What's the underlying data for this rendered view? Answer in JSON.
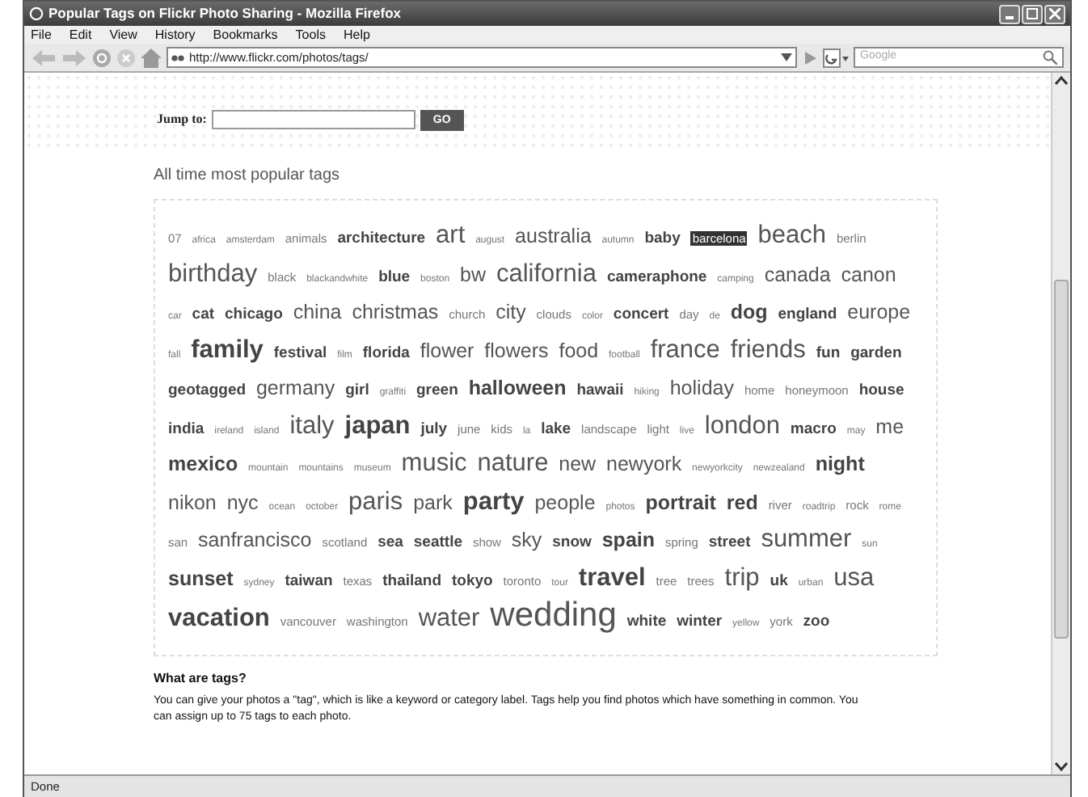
{
  "window": {
    "title": "Popular Tags on Flickr Photo Sharing - Mozilla Firefox"
  },
  "menu": [
    "File",
    "Edit",
    "View",
    "History",
    "Bookmarks",
    "Tools",
    "Help"
  ],
  "address_bar": {
    "url": "http://www.flickr.com/photos/tags/"
  },
  "search": {
    "placeholder": "Google"
  },
  "jump": {
    "label": "Jump to:",
    "button": "GO"
  },
  "heading": "All time most popular tags",
  "tags": [
    {
      "label": "07",
      "kind": "small",
      "bold": false,
      "selected": false
    },
    {
      "label": "africa",
      "kind": "tiny",
      "bold": false,
      "selected": false
    },
    {
      "label": "amsterdam",
      "kind": "tiny",
      "bold": false,
      "selected": false
    },
    {
      "label": "animals",
      "kind": "small",
      "bold": false,
      "selected": false
    },
    {
      "label": "architecture",
      "kind": "medium",
      "bold": true,
      "selected": false
    },
    {
      "label": "art",
      "kind": "huge",
      "bold": false,
      "selected": false
    },
    {
      "label": "august",
      "kind": "tiny",
      "bold": false,
      "selected": false
    },
    {
      "label": "australia",
      "kind": "large",
      "bold": false,
      "selected": false
    },
    {
      "label": "autumn",
      "kind": "tiny",
      "bold": false,
      "selected": false
    },
    {
      "label": "baby",
      "kind": "medium",
      "bold": true,
      "selected": false
    },
    {
      "label": "barcelona",
      "kind": "small",
      "bold": false,
      "selected": true
    },
    {
      "label": "beach",
      "kind": "huge",
      "bold": false,
      "selected": false
    },
    {
      "label": "berlin",
      "kind": "small",
      "bold": false,
      "selected": false
    },
    {
      "label": "birthday",
      "kind": "huge",
      "bold": false,
      "selected": false
    },
    {
      "label": "black",
      "kind": "small",
      "bold": false,
      "selected": false
    },
    {
      "label": "blackandwhite",
      "kind": "tiny",
      "bold": false,
      "selected": false
    },
    {
      "label": "blue",
      "kind": "medium",
      "bold": true,
      "selected": false
    },
    {
      "label": "boston",
      "kind": "tiny",
      "bold": false,
      "selected": false
    },
    {
      "label": "bw",
      "kind": "large",
      "bold": false,
      "selected": false
    },
    {
      "label": "california",
      "kind": "huge",
      "bold": false,
      "selected": false
    },
    {
      "label": "cameraphone",
      "kind": "medium",
      "bold": true,
      "selected": false
    },
    {
      "label": "camping",
      "kind": "tiny",
      "bold": false,
      "selected": false
    },
    {
      "label": "canada",
      "kind": "large",
      "bold": false,
      "selected": false
    },
    {
      "label": "canon",
      "kind": "large",
      "bold": false,
      "selected": false
    },
    {
      "label": "car",
      "kind": "tiny",
      "bold": false,
      "selected": false
    },
    {
      "label": "cat",
      "kind": "medium",
      "bold": true,
      "selected": false
    },
    {
      "label": "chicago",
      "kind": "medium",
      "bold": true,
      "selected": false
    },
    {
      "label": "china",
      "kind": "large",
      "bold": false,
      "selected": false
    },
    {
      "label": "christmas",
      "kind": "large",
      "bold": false,
      "selected": false
    },
    {
      "label": "church",
      "kind": "small",
      "bold": false,
      "selected": false
    },
    {
      "label": "city",
      "kind": "large",
      "bold": false,
      "selected": false
    },
    {
      "label": "clouds",
      "kind": "small",
      "bold": false,
      "selected": false
    },
    {
      "label": "color",
      "kind": "tiny",
      "bold": false,
      "selected": false
    },
    {
      "label": "concert",
      "kind": "medium",
      "bold": true,
      "selected": false
    },
    {
      "label": "day",
      "kind": "small",
      "bold": false,
      "selected": false
    },
    {
      "label": "de",
      "kind": "tiny",
      "bold": false,
      "selected": false
    },
    {
      "label": "dog",
      "kind": "large",
      "bold": true,
      "selected": false
    },
    {
      "label": "england",
      "kind": "medium",
      "bold": true,
      "selected": false
    },
    {
      "label": "europe",
      "kind": "large",
      "bold": false,
      "selected": false
    },
    {
      "label": "fall",
      "kind": "tiny",
      "bold": false,
      "selected": false
    },
    {
      "label": "family",
      "kind": "huge",
      "bold": true,
      "selected": false
    },
    {
      "label": "festival",
      "kind": "medium",
      "bold": true,
      "selected": false
    },
    {
      "label": "film",
      "kind": "tiny",
      "bold": false,
      "selected": false
    },
    {
      "label": "florida",
      "kind": "medium",
      "bold": true,
      "selected": false
    },
    {
      "label": "flower",
      "kind": "large",
      "bold": false,
      "selected": false
    },
    {
      "label": "flowers",
      "kind": "large",
      "bold": false,
      "selected": false
    },
    {
      "label": "food",
      "kind": "large",
      "bold": false,
      "selected": false
    },
    {
      "label": "football",
      "kind": "tiny",
      "bold": false,
      "selected": false
    },
    {
      "label": "france",
      "kind": "huge",
      "bold": false,
      "selected": false
    },
    {
      "label": "friends",
      "kind": "huge",
      "bold": false,
      "selected": false
    },
    {
      "label": "fun",
      "kind": "medium",
      "bold": true,
      "selected": false
    },
    {
      "label": "garden",
      "kind": "medium",
      "bold": true,
      "selected": false
    },
    {
      "label": "geotagged",
      "kind": "medium",
      "bold": true,
      "selected": false
    },
    {
      "label": "germany",
      "kind": "large",
      "bold": false,
      "selected": false
    },
    {
      "label": "girl",
      "kind": "medium",
      "bold": true,
      "selected": false
    },
    {
      "label": "graffiti",
      "kind": "tiny",
      "bold": false,
      "selected": false
    },
    {
      "label": "green",
      "kind": "medium",
      "bold": true,
      "selected": false
    },
    {
      "label": "halloween",
      "kind": "large",
      "bold": true,
      "selected": false
    },
    {
      "label": "hawaii",
      "kind": "medium",
      "bold": true,
      "selected": false
    },
    {
      "label": "hiking",
      "kind": "tiny",
      "bold": false,
      "selected": false
    },
    {
      "label": "holiday",
      "kind": "large",
      "bold": false,
      "selected": false
    },
    {
      "label": "home",
      "kind": "small",
      "bold": false,
      "selected": false
    },
    {
      "label": "honeymoon",
      "kind": "small",
      "bold": false,
      "selected": false
    },
    {
      "label": "house",
      "kind": "medium",
      "bold": true,
      "selected": false
    },
    {
      "label": "india",
      "kind": "medium",
      "bold": true,
      "selected": false
    },
    {
      "label": "ireland",
      "kind": "tiny",
      "bold": false,
      "selected": false
    },
    {
      "label": "island",
      "kind": "tiny",
      "bold": false,
      "selected": false
    },
    {
      "label": "italy",
      "kind": "huge",
      "bold": false,
      "selected": false
    },
    {
      "label": "japan",
      "kind": "huge",
      "bold": true,
      "selected": false
    },
    {
      "label": "july",
      "kind": "medium",
      "bold": true,
      "selected": false
    },
    {
      "label": "june",
      "kind": "small",
      "bold": false,
      "selected": false
    },
    {
      "label": "kids",
      "kind": "small",
      "bold": false,
      "selected": false
    },
    {
      "label": "la",
      "kind": "tiny",
      "bold": false,
      "selected": false
    },
    {
      "label": "lake",
      "kind": "medium",
      "bold": true,
      "selected": false
    },
    {
      "label": "landscape",
      "kind": "small",
      "bold": false,
      "selected": false
    },
    {
      "label": "light",
      "kind": "small",
      "bold": false,
      "selected": false
    },
    {
      "label": "live",
      "kind": "tiny",
      "bold": false,
      "selected": false
    },
    {
      "label": "london",
      "kind": "huge",
      "bold": false,
      "selected": false
    },
    {
      "label": "macro",
      "kind": "medium",
      "bold": true,
      "selected": false
    },
    {
      "label": "may",
      "kind": "tiny",
      "bold": false,
      "selected": false
    },
    {
      "label": "me",
      "kind": "large",
      "bold": false,
      "selected": false
    },
    {
      "label": "mexico",
      "kind": "large",
      "bold": true,
      "selected": false
    },
    {
      "label": "mountain",
      "kind": "tiny",
      "bold": false,
      "selected": false
    },
    {
      "label": "mountains",
      "kind": "tiny",
      "bold": false,
      "selected": false
    },
    {
      "label": "museum",
      "kind": "tiny",
      "bold": false,
      "selected": false
    },
    {
      "label": "music",
      "kind": "huge",
      "bold": false,
      "selected": false
    },
    {
      "label": "nature",
      "kind": "huge",
      "bold": false,
      "selected": false
    },
    {
      "label": "new",
      "kind": "large",
      "bold": false,
      "selected": false
    },
    {
      "label": "newyork",
      "kind": "large",
      "bold": false,
      "selected": false
    },
    {
      "label": "newyorkcity",
      "kind": "tiny",
      "bold": false,
      "selected": false
    },
    {
      "label": "newzealand",
      "kind": "tiny",
      "bold": false,
      "selected": false
    },
    {
      "label": "night",
      "kind": "large",
      "bold": true,
      "selected": false
    },
    {
      "label": "nikon",
      "kind": "large",
      "bold": false,
      "selected": false
    },
    {
      "label": "nyc",
      "kind": "large",
      "bold": false,
      "selected": false
    },
    {
      "label": "ocean",
      "kind": "tiny",
      "bold": false,
      "selected": false
    },
    {
      "label": "october",
      "kind": "tiny",
      "bold": false,
      "selected": false
    },
    {
      "label": "paris",
      "kind": "huge",
      "bold": false,
      "selected": false
    },
    {
      "label": "park",
      "kind": "large",
      "bold": false,
      "selected": false
    },
    {
      "label": "party",
      "kind": "huge",
      "bold": true,
      "selected": false
    },
    {
      "label": "people",
      "kind": "large",
      "bold": false,
      "selected": false
    },
    {
      "label": "photos",
      "kind": "tiny",
      "bold": false,
      "selected": false
    },
    {
      "label": "portrait",
      "kind": "large",
      "bold": true,
      "selected": false
    },
    {
      "label": "red",
      "kind": "large",
      "bold": true,
      "selected": false
    },
    {
      "label": "river",
      "kind": "small",
      "bold": false,
      "selected": false
    },
    {
      "label": "roadtrip",
      "kind": "tiny",
      "bold": false,
      "selected": false
    },
    {
      "label": "rock",
      "kind": "small",
      "bold": false,
      "selected": false
    },
    {
      "label": "rome",
      "kind": "tiny",
      "bold": false,
      "selected": false
    },
    {
      "label": "san",
      "kind": "small",
      "bold": false,
      "selected": false
    },
    {
      "label": "sanfrancisco",
      "kind": "large",
      "bold": false,
      "selected": false
    },
    {
      "label": "scotland",
      "kind": "small",
      "bold": false,
      "selected": false
    },
    {
      "label": "sea",
      "kind": "medium",
      "bold": true,
      "selected": false
    },
    {
      "label": "seattle",
      "kind": "medium",
      "bold": true,
      "selected": false
    },
    {
      "label": "show",
      "kind": "small",
      "bold": false,
      "selected": false
    },
    {
      "label": "sky",
      "kind": "large",
      "bold": false,
      "selected": false
    },
    {
      "label": "snow",
      "kind": "medium",
      "bold": true,
      "selected": false
    },
    {
      "label": "spain",
      "kind": "large",
      "bold": true,
      "selected": false
    },
    {
      "label": "spring",
      "kind": "small",
      "bold": false,
      "selected": false
    },
    {
      "label": "street",
      "kind": "medium",
      "bold": true,
      "selected": false
    },
    {
      "label": "summer",
      "kind": "huge",
      "bold": false,
      "selected": false
    },
    {
      "label": "sun",
      "kind": "tiny",
      "bold": false,
      "selected": false
    },
    {
      "label": "sunset",
      "kind": "large",
      "bold": true,
      "selected": false
    },
    {
      "label": "sydney",
      "kind": "tiny",
      "bold": false,
      "selected": false
    },
    {
      "label": "taiwan",
      "kind": "medium",
      "bold": true,
      "selected": false
    },
    {
      "label": "texas",
      "kind": "small",
      "bold": false,
      "selected": false
    },
    {
      "label": "thailand",
      "kind": "medium",
      "bold": true,
      "selected": false
    },
    {
      "label": "tokyo",
      "kind": "medium",
      "bold": true,
      "selected": false
    },
    {
      "label": "toronto",
      "kind": "small",
      "bold": false,
      "selected": false
    },
    {
      "label": "tour",
      "kind": "tiny",
      "bold": false,
      "selected": false
    },
    {
      "label": "travel",
      "kind": "huge",
      "bold": true,
      "selected": false
    },
    {
      "label": "tree",
      "kind": "small",
      "bold": false,
      "selected": false
    },
    {
      "label": "trees",
      "kind": "small",
      "bold": false,
      "selected": false
    },
    {
      "label": "trip",
      "kind": "huge",
      "bold": false,
      "selected": false
    },
    {
      "label": "uk",
      "kind": "medium",
      "bold": true,
      "selected": false
    },
    {
      "label": "urban",
      "kind": "tiny",
      "bold": false,
      "selected": false
    },
    {
      "label": "usa",
      "kind": "huge",
      "bold": false,
      "selected": false
    },
    {
      "label": "vacation",
      "kind": "huge",
      "bold": true,
      "selected": false
    },
    {
      "label": "vancouver",
      "kind": "small",
      "bold": false,
      "selected": false
    },
    {
      "label": "washington",
      "kind": "small",
      "bold": false,
      "selected": false
    },
    {
      "label": "water",
      "kind": "huge",
      "bold": false,
      "selected": false
    },
    {
      "label": "wedding",
      "kind": "giant",
      "bold": false,
      "selected": false
    },
    {
      "label": "white",
      "kind": "medium",
      "bold": true,
      "selected": false
    },
    {
      "label": "winter",
      "kind": "medium",
      "bold": true,
      "selected": false
    },
    {
      "label": "yellow",
      "kind": "tiny",
      "bold": false,
      "selected": false
    },
    {
      "label": "york",
      "kind": "small",
      "bold": false,
      "selected": false
    },
    {
      "label": "zoo",
      "kind": "medium",
      "bold": true,
      "selected": false
    }
  ],
  "info": {
    "title": "What are tags?",
    "text": "You can give your photos a \"tag\", which is like a keyword or category label. Tags help you find photos which have something in common. You can assign up to 75 tags to each photo."
  },
  "status_bar": "Done"
}
